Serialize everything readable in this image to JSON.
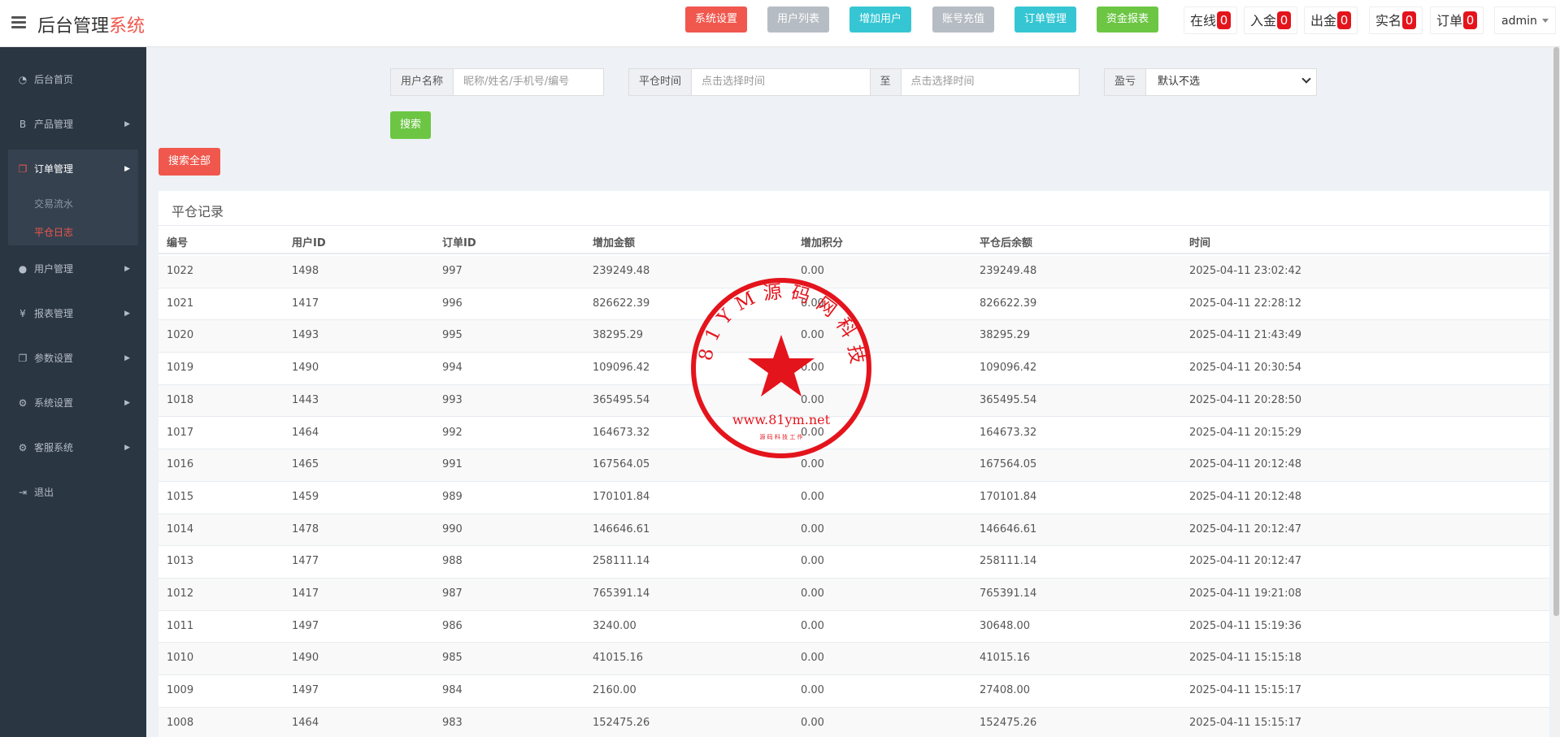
{
  "header": {
    "brand_main": "后台管理",
    "brand_accent": "系统",
    "buttons": [
      {
        "label": "系统设置",
        "color": "#f0574d"
      },
      {
        "label": "用户列表",
        "color": "#b6bcc3"
      },
      {
        "label": "增加用户",
        "color": "#36c6d3"
      },
      {
        "label": "账号充值",
        "color": "#b6bcc3"
      },
      {
        "label": "订单管理",
        "color": "#36c6d3"
      },
      {
        "label": "资金报表",
        "color": "#6cc644"
      }
    ],
    "stats": [
      {
        "label": "在线",
        "count": "0"
      },
      {
        "label": "入金",
        "count": "0"
      },
      {
        "label": "出金",
        "count": "0"
      },
      {
        "label": "实名",
        "count": "0"
      },
      {
        "label": "订单",
        "count": "0"
      }
    ],
    "user": "admin"
  },
  "sidebar": {
    "items": [
      {
        "label": "后台首页",
        "icon": "dashboard-icon"
      },
      {
        "label": "产品管理",
        "icon": "bitcoin-icon"
      },
      {
        "label": "订单管理",
        "icon": "copy-icon"
      },
      {
        "label": "用户管理",
        "icon": "user-icon"
      },
      {
        "label": "报表管理",
        "icon": "yen-icon"
      },
      {
        "label": "参数设置",
        "icon": "copy-icon"
      },
      {
        "label": "系统设置",
        "icon": "gears-icon"
      },
      {
        "label": "客服系统",
        "icon": "gears-icon"
      },
      {
        "label": "退出",
        "icon": "sign-out-icon"
      }
    ],
    "submenu": [
      {
        "label": "交易流水"
      },
      {
        "label": "平仓日志"
      }
    ]
  },
  "search": {
    "username_label": "用户名称",
    "username_placeholder": "昵称/姓名/手机号/编号",
    "time_label": "平仓时间",
    "time_start_placeholder": "点击选择时间",
    "time_sep": "至",
    "time_end_placeholder": "点击选择时间",
    "pnl_label": "盈亏",
    "pnl_value": "默认不选",
    "search_button": "搜索",
    "search_all_button": "搜索全部"
  },
  "table": {
    "title": "平仓记录",
    "columns": [
      "编号",
      "用户ID",
      "订单ID",
      "增加金额",
      "增加积分",
      "平仓后余额",
      "时间"
    ],
    "rows": [
      [
        "1022",
        "1498",
        "997",
        "239249.48",
        "0.00",
        "239249.48",
        "2025-04-11 23:02:42"
      ],
      [
        "1021",
        "1417",
        "996",
        "826622.39",
        "0.00",
        "826622.39",
        "2025-04-11 22:28:12"
      ],
      [
        "1020",
        "1493",
        "995",
        "38295.29",
        "0.00",
        "38295.29",
        "2025-04-11 21:43:49"
      ],
      [
        "1019",
        "1490",
        "994",
        "109096.42",
        "0.00",
        "109096.42",
        "2025-04-11 20:30:54"
      ],
      [
        "1018",
        "1443",
        "993",
        "365495.54",
        "0.00",
        "365495.54",
        "2025-04-11 20:28:50"
      ],
      [
        "1017",
        "1464",
        "992",
        "164673.32",
        "0.00",
        "164673.32",
        "2025-04-11 20:15:29"
      ],
      [
        "1016",
        "1465",
        "991",
        "167564.05",
        "0.00",
        "167564.05",
        "2025-04-11 20:12:48"
      ],
      [
        "1015",
        "1459",
        "989",
        "170101.84",
        "0.00",
        "170101.84",
        "2025-04-11 20:12:48"
      ],
      [
        "1014",
        "1478",
        "990",
        "146646.61",
        "0.00",
        "146646.61",
        "2025-04-11 20:12:47"
      ],
      [
        "1013",
        "1477",
        "988",
        "258111.14",
        "0.00",
        "258111.14",
        "2025-04-11 20:12:47"
      ],
      [
        "1012",
        "1417",
        "987",
        "765391.14",
        "0.00",
        "765391.14",
        "2025-04-11 19:21:08"
      ],
      [
        "1011",
        "1497",
        "986",
        "3240.00",
        "0.00",
        "30648.00",
        "2025-04-11 15:19:36"
      ],
      [
        "1010",
        "1490",
        "985",
        "41015.16",
        "0.00",
        "41015.16",
        "2025-04-11 15:15:18"
      ],
      [
        "1009",
        "1497",
        "984",
        "2160.00",
        "0.00",
        "27408.00",
        "2025-04-11 15:15:17"
      ],
      [
        "1008",
        "1464",
        "983",
        "152475.26",
        "0.00",
        "152475.26",
        "2025-04-11 15:15:17"
      ]
    ]
  },
  "watermark": {
    "ring_text": "8 1 Y M 源 码 网 科 技",
    "url": "www.81ym.net",
    "sub_text": "源 码 科 技 工 作",
    "color": "#e4141c"
  }
}
